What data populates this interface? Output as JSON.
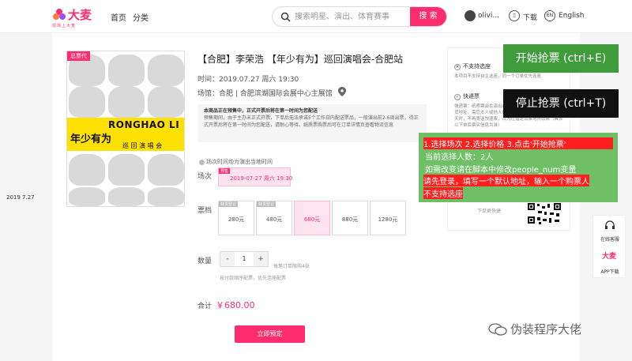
{
  "header": {
    "logo_text": "大麦",
    "logo_sub": "现场上大麦",
    "nav": [
      "首页",
      "分类"
    ],
    "search": {
      "placeholder": "搜索明星、演出、体育赛事",
      "button": "搜 索"
    },
    "user_name": "olivi...",
    "download": "下载",
    "lang_badge": "EN",
    "lang": "English"
  },
  "poster": {
    "tag": "总票代",
    "name": "RONGHAO LI",
    "title": "年少有为",
    "subtitle": "巡 回 演 唱 会",
    "date": "2019  7.27"
  },
  "event": {
    "title": "【合肥】李荣浩 【年少有为】巡回演唱会-合肥站",
    "time_label": "时间：",
    "time": "2019.07.27 周六 19:30",
    "venue_label": "场馆：",
    "venue": "合肥 | 合肥滨湖国际会展中心主展馆"
  },
  "notice": {
    "bold": "本商品正在预售中，正式开票后将在第一时间为您配送",
    "text": "预售期间，由于主办未正式开票，下单后无法承诺5个工作日内配送票品，一般演出前2-6周出票，待正式开票后将在第一时间为您配送，请耐心等待。纸质票购票后可在订单详情页查看物流信息"
  },
  "hint": "场次时间均为演出当地时间",
  "session": {
    "label": "场次",
    "tag": "预售",
    "value": "2019-07-27 周六 19:30"
  },
  "prices": {
    "label": "票档",
    "tag": "缺货登记",
    "items": [
      "280元",
      "480元",
      "680元",
      "880元",
      "1280元"
    ],
    "selected": "680元"
  },
  "quantity": {
    "label": "数量",
    "minus": "-",
    "plus": "+",
    "value": "1",
    "limit_note": "每笔订单限购4张",
    "sub_note": "按付款顺序配票，优先连座配票"
  },
  "total": {
    "label": "合计",
    "value": "￥680.00"
  },
  "buy_button": "立即预定",
  "side_panel": {
    "h1": "不支持选座",
    "t1": "本项目不支持自主选座，同一个订单优先连座",
    "h2": "快递票",
    "t2": "快递票：纸质票会在演出前以快递形式送达，请您确认收货地址，需您本人或他人持有效证件到指定地点取票仅4天时，不再寄送快递票，改为在指定取票地点取票（具体以下单后票实信息为准）",
    "more": "下单更快捷"
  },
  "float_bar": {
    "service": "在线客服",
    "app_logo": "大麦",
    "app": "APP下载"
  },
  "overlay": {
    "start": "开始抢票 (ctrl+E)",
    "stop": "停止抢票 (ctrl+T)",
    "lines": [
      "1.选择场次 2.选择价格 3.点击'开始抢票'",
      "当前选择人数：2人",
      "如需改变请在脚本中修改people_num变量",
      "请先登录，填写一个默认地址，输入一个购票人",
      "不支持选座"
    ]
  },
  "watermark": "伪装程序大佬",
  "colors": {
    "brand": "#ff2d6f",
    "start": "#3e9c3a",
    "stop": "#111111",
    "info": "#6fbf66",
    "alert": "#ff1f1f"
  }
}
